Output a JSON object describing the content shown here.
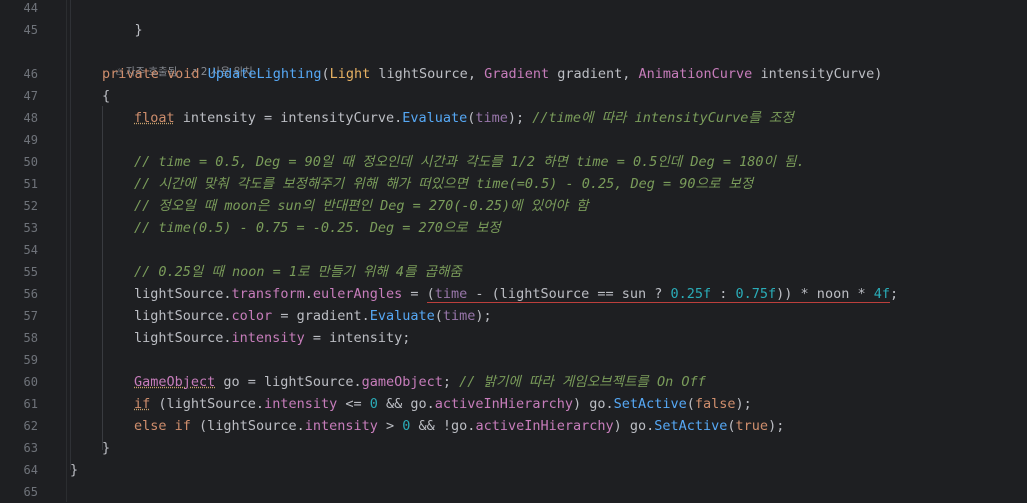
{
  "line_numbers": [
    "44",
    "45",
    "",
    "46",
    "47",
    "48",
    "49",
    "50",
    "51",
    "52",
    "53",
    "54",
    "55",
    "56",
    "57",
    "58",
    "59",
    "60",
    "61",
    "62",
    "63",
    "64",
    "65"
  ],
  "hint": {
    "usage_frequent": "자주 호출됨",
    "usage_count": "2 사용 위치"
  },
  "code": {
    "l44": "}",
    "l46": {
      "kw1": "private",
      "kw2": "void",
      "fn": "UpdateLighting",
      "p1": "(",
      "t1": "Light",
      "a1": " lightSource, ",
      "t2": "Gradient",
      "a2": " gradient, ",
      "t3": "AnimationCurve",
      "a3": " intensityCurve)"
    },
    "l47": "{",
    "l48": {
      "kw": "float",
      "a": " intensity = intensityCurve.",
      "m": "Evaluate",
      "b": "(",
      "p": "time",
      "c": "); ",
      "cm": "//time에 따라 intensityCurve를 조정"
    },
    "l50": "// time = 0.5, Deg = 90일 때 정오인데 시간과 각도를 1/2 하면 time = 0.5인데 Deg = 180이 됨.",
    "l51": "// 시간에 맞춰 각도를 보정해주기 위해 해가 떠있으면 time(=0.5) - 0.25, Deg = 90으로 보정",
    "l52": "// 정오일 때 moon은 sun의 반대편인 Deg = 270(-0.25)에 있어야 함",
    "l53": "// time(0.5) - 0.75 = -0.25. Deg = 270으로 보정",
    "l55": "// 0.25일 때 noon = 1로 만들기 위해 4를 곱해줌",
    "l56": {
      "a": "lightSource.",
      "m1": "transform",
      "d1": ".",
      "m2": "eulerAngles",
      "b": " = ",
      "e1": "(",
      "e2": "time",
      "e3": " - (lightSource == sun ? ",
      "n1": "0.25f",
      "e4": " : ",
      "n2": "0.75f",
      "e5": ")) * noon * ",
      "n3": "4f",
      "e6": ";"
    },
    "l57": {
      "a": "lightSource.",
      "m": "color",
      "b": " = gradient.",
      "f": "Evaluate",
      "c": "(",
      "p": "time",
      "d": ");"
    },
    "l58": {
      "a": "lightSource.",
      "m": "intensity",
      "b": " = intensity;"
    },
    "l60": {
      "t": "GameObject",
      "a": " go = lightSource.",
      "m": "gameObject",
      "b": "; ",
      "cm": "// 밝기에 따라 게임오브젝트를 On Off"
    },
    "l61": {
      "kw": "if",
      "a": " (lightSource.",
      "m": "intensity",
      "b": " <= ",
      "n": "0",
      "c": " && go.",
      "m2": "activeInHierarchy",
      "d": ") go.",
      "f": "SetActive",
      "e": "(",
      "k2": "false",
      "g": ");"
    },
    "l62": {
      "kw1": "else",
      "kw2": "if",
      "a": " (lightSource.",
      "m": "intensity",
      "b": " > ",
      "n": "0",
      "c": " && !go.",
      "m2": "activeInHierarchy",
      "d": ") go.",
      "f": "SetActive",
      "e": "(",
      "k2": "true",
      "g": ");"
    },
    "l63": "}",
    "l64": "}"
  }
}
